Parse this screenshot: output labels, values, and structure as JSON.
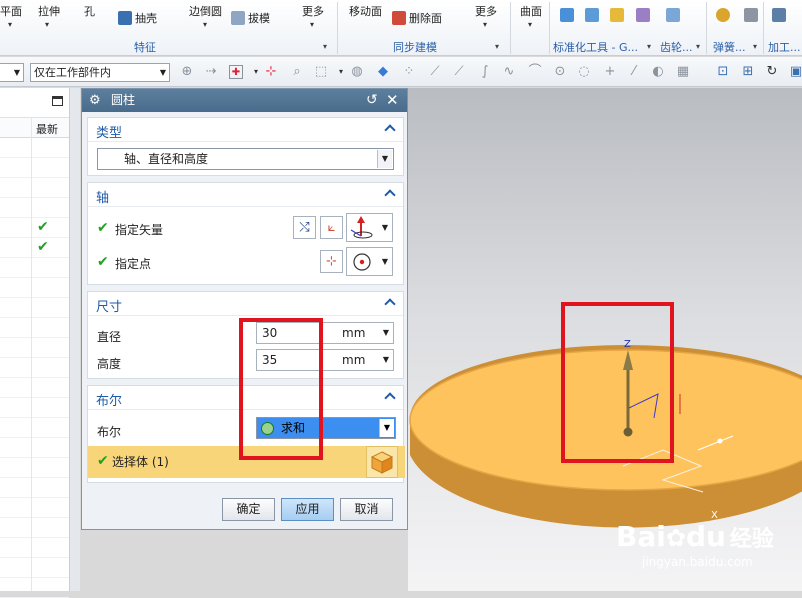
{
  "ribbon": {
    "buttons": {
      "datum_plane": "基准平面",
      "extrude": "拉伸",
      "hole": "孔",
      "shell": "抽壳",
      "edge_blend": "边倒圆",
      "draft": "拔模",
      "more1": "更多",
      "move_face": "移动面",
      "delete_face": "删除面",
      "more2": "更多",
      "surface": "曲面"
    },
    "groups": {
      "feature": "特征",
      "sync_modeling": "同步建模",
      "standard_tools": "标准化工具 - G...",
      "gear": "齿轮...",
      "spring": "弹簧...",
      "machining": "加工..."
    }
  },
  "toolbar": {
    "filter_combo": "仅在工作部件内"
  },
  "navigator": {
    "column_latest": "最新",
    "rows": [
      {
        "check": ""
      },
      {
        "check": ""
      },
      {
        "check": ""
      },
      {
        "check": ""
      },
      {
        "check": "✔"
      },
      {
        "check": "✔"
      },
      {
        "check": ""
      },
      {
        "check": ""
      },
      {
        "check": ""
      },
      {
        "check": ""
      },
      {
        "check": ""
      },
      {
        "check": ""
      },
      {
        "check": ""
      },
      {
        "check": ""
      },
      {
        "check": ""
      },
      {
        "check": ""
      },
      {
        "check": ""
      },
      {
        "check": ""
      },
      {
        "check": ""
      },
      {
        "check": ""
      },
      {
        "check": ""
      },
      {
        "check": ""
      },
      {
        "check": ""
      }
    ]
  },
  "dialog": {
    "title": "圆柱",
    "type": {
      "header": "类型",
      "value": "轴、直径和高度"
    },
    "axis": {
      "header": "轴",
      "vector_label": "指定矢量",
      "point_label": "指定点"
    },
    "dimensions": {
      "header": "尺寸",
      "diameter_label": "直径",
      "diameter_value": "30",
      "diameter_unit": "mm",
      "height_label": "高度",
      "height_value": "35",
      "height_unit": "mm"
    },
    "boolean": {
      "header": "布尔",
      "label": "布尔",
      "value": "求和",
      "select_body": "选择体 (1)"
    },
    "buttons": {
      "ok": "确定",
      "apply": "应用",
      "cancel": "取消"
    }
  },
  "viewport": {
    "axis_z": "Z",
    "axis_x": "X"
  },
  "watermark": {
    "brand_a": "Bai",
    "brand_b": "du",
    "site": "经验",
    "url": "jingyan.baidu.com"
  },
  "colors": {
    "accent": "#1e5aa8",
    "highlight_box": "#e0141e",
    "disk_top": "#fec35c",
    "disk_side": "#cc8f35",
    "selection_bar": "#f9d57a",
    "boolean_select": "#3c8ff0"
  }
}
